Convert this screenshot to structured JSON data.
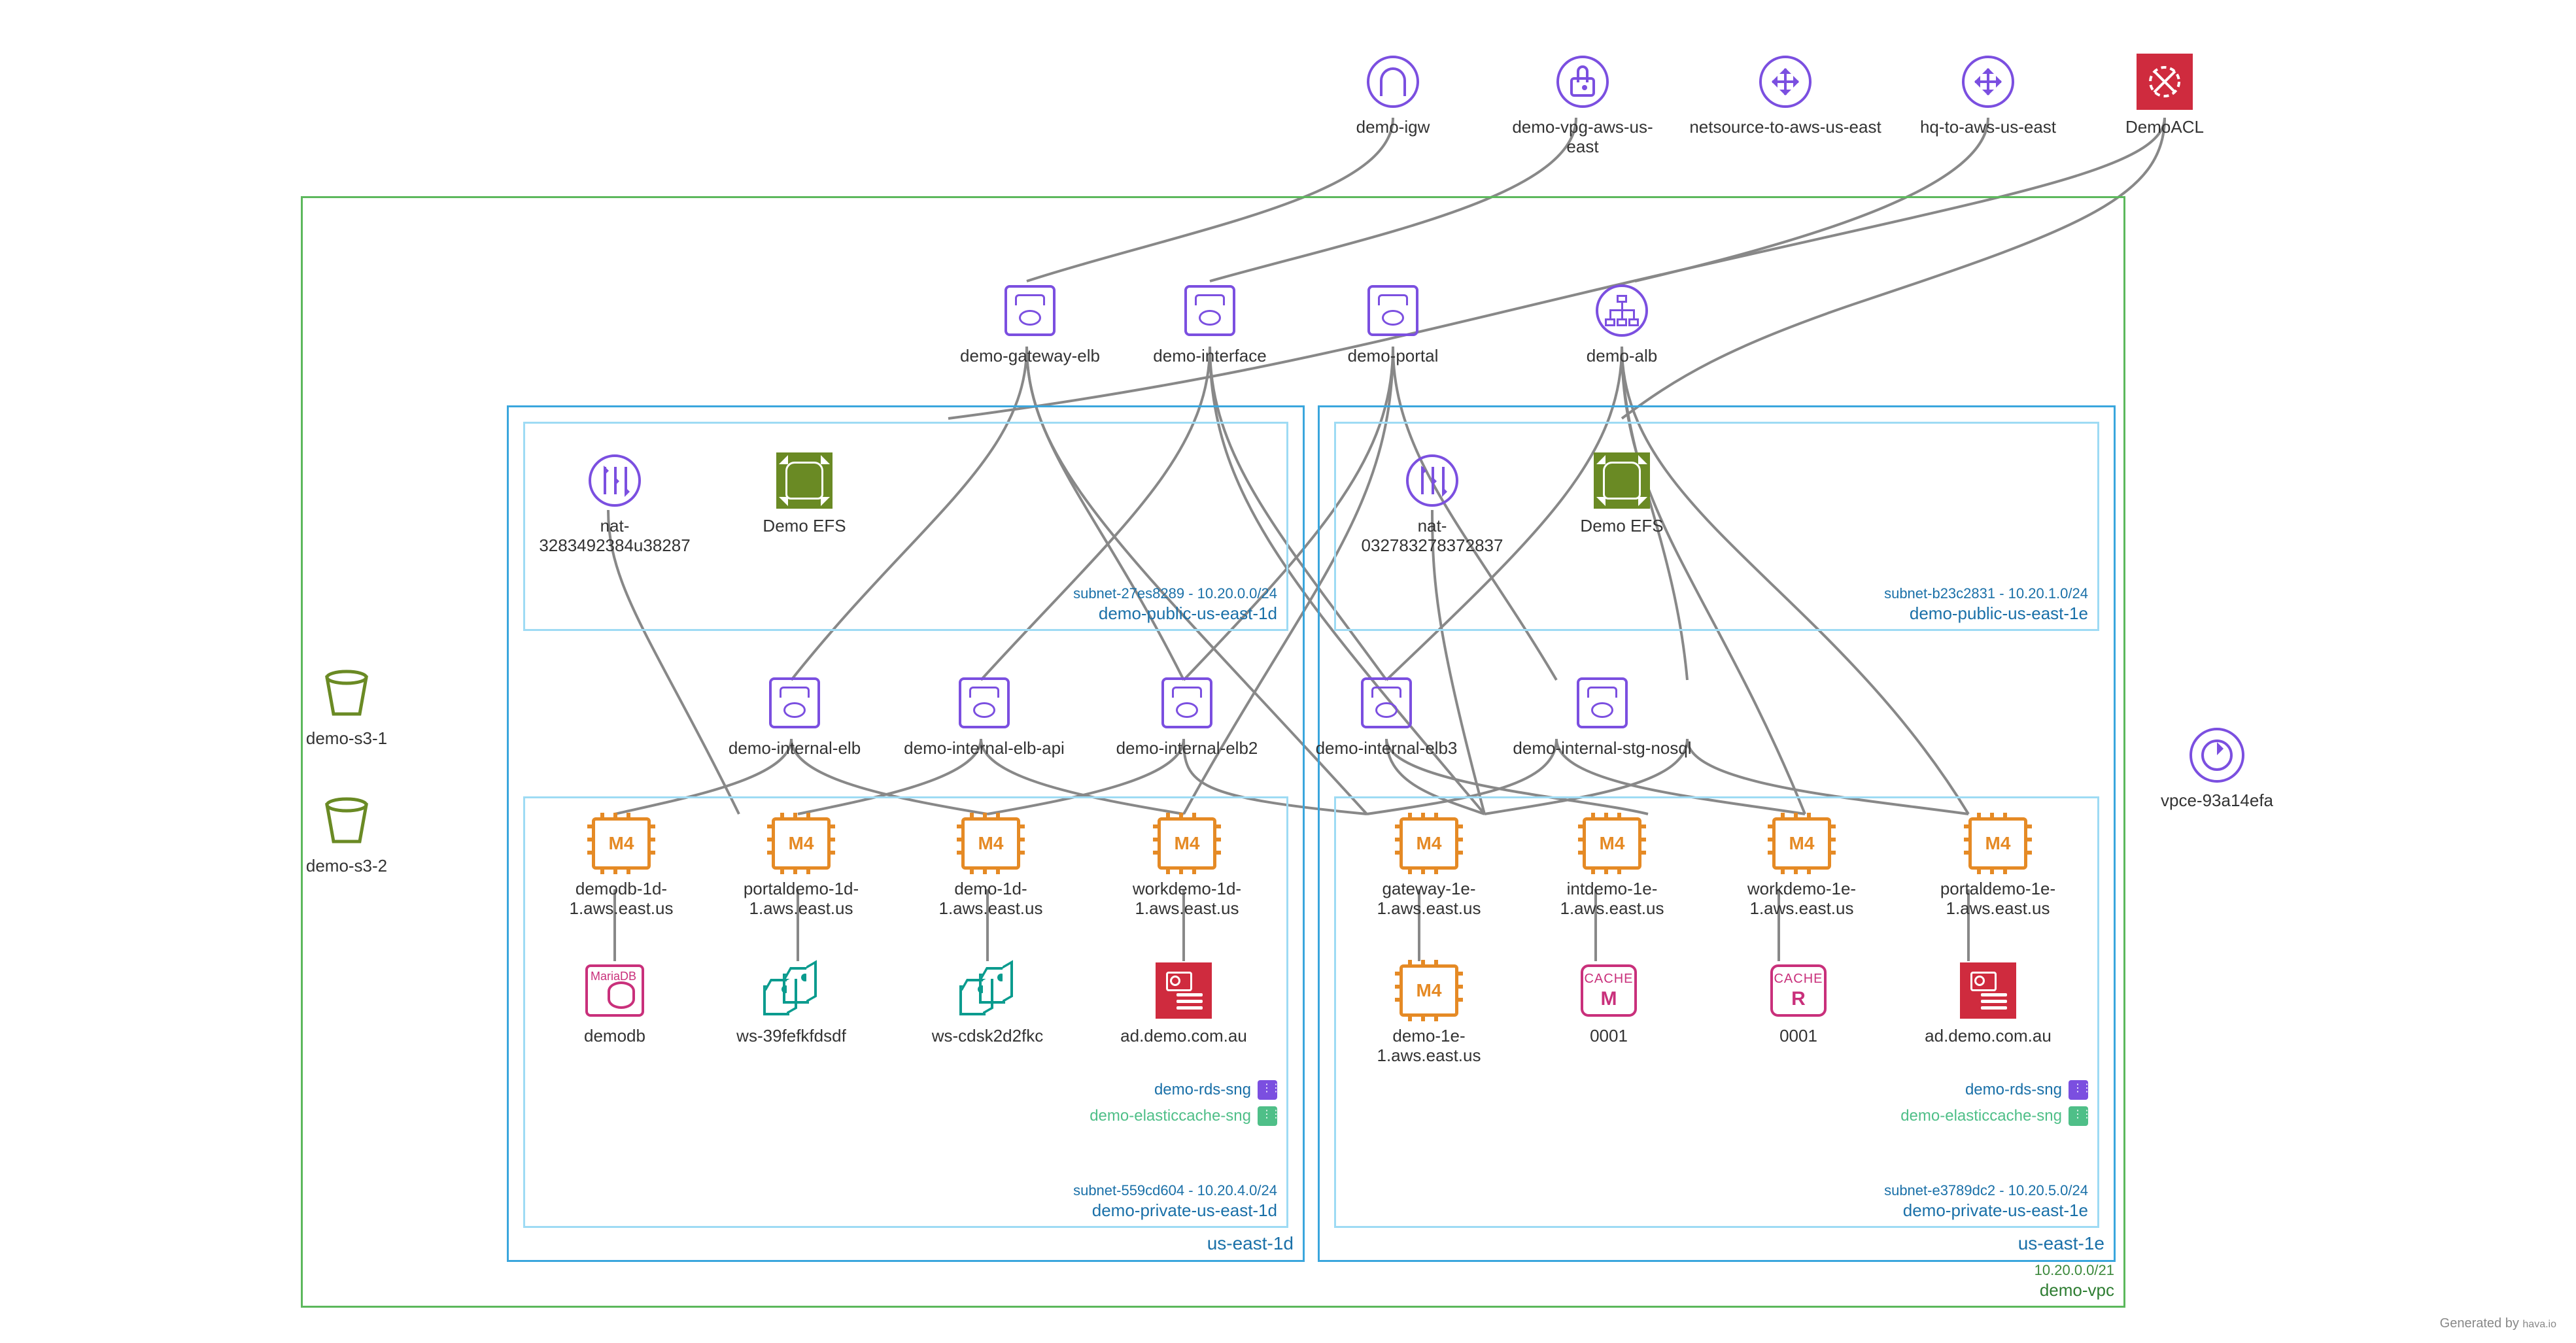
{
  "footer": {
    "text": "Generated by ",
    "link": "hava.io"
  },
  "vpc": {
    "cidr": "10.20.0.0/21",
    "name": "demo-vpc"
  },
  "az_d": {
    "name": "us-east-1d"
  },
  "az_e": {
    "name": "us-east-1e"
  },
  "sub": {
    "pub_d": {
      "id": "subnet-27es8289 - 10.20.0.0/24",
      "name": "demo-public-us-east-1d"
    },
    "pub_e": {
      "id": "subnet-b23c2831 - 10.20.1.0/24",
      "name": "demo-public-us-east-1e"
    },
    "priv_d": {
      "id": "subnet-559cd604 - 10.20.4.0/24",
      "name": "demo-private-us-east-1d"
    },
    "priv_e": {
      "id": "subnet-e3789dc2 - 10.20.5.0/24",
      "name": "demo-private-us-east-1e"
    }
  },
  "sng": {
    "rds": "demo-rds-sng",
    "elc": "demo-elasticcache-sng"
  },
  "top": {
    "igw": "demo-igw",
    "vpg": "demo-vpg-aws-us-east",
    "cgw1": "netsource-to-aws-us-east",
    "cgw2": "hq-to-aws-us-east",
    "acl": "DemoACL"
  },
  "elb_row": {
    "gateway": "demo-gateway-elb",
    "interface": "demo-interface",
    "portal": "demo-portal",
    "alb": "demo-alb"
  },
  "pubnodes": {
    "nat_d": "nat-3283492384u38287",
    "efs_d": "Demo EFS",
    "nat_e": "nat-032783278372837",
    "efs_e": "Demo EFS"
  },
  "int_elb": {
    "a": "demo-internal-elb",
    "b": "demo-internal-elb-api",
    "c": "demo-internal-elb2",
    "d": "demo-internal-elb3",
    "e": "demo-internal-stg-nosql"
  },
  "ec2_row": {
    "d1": "demodb-1d-1.aws.east.us",
    "d2": "portaldemo-1d-1.aws.east.us",
    "d3": "demo-1d-1.aws.east.us",
    "d4": "workdemo-1d-1.aws.east.us",
    "e1": "gateway-1e-1.aws.east.us",
    "e2": "intdemo-1e-1.aws.east.us",
    "e3": "workdemo-1e-1.aws.east.us",
    "e4": "portaldemo-1e-1.aws.east.us"
  },
  "ec2_type": "M4",
  "bottom_row": {
    "rds": {
      "engine": "MariaDB",
      "label": "demodb"
    },
    "ws1": "ws-39fefkfdsdf",
    "ws2": "ws-cdsk2d2fkc",
    "ds_d": "ad.demo.com.au",
    "ec2e5": "demo-1e-1.aws.east.us",
    "cacheM": {
      "top": "CACHE",
      "b": "M",
      "label": "0001"
    },
    "cacheR": {
      "top": "CACHE",
      "b": "R",
      "label": "0001"
    },
    "ds_e": "ad.demo.com.au"
  },
  "side": {
    "s3a": "demo-s3-1",
    "s3b": "demo-s3-2",
    "vpce": "vpce-93a14efa"
  }
}
